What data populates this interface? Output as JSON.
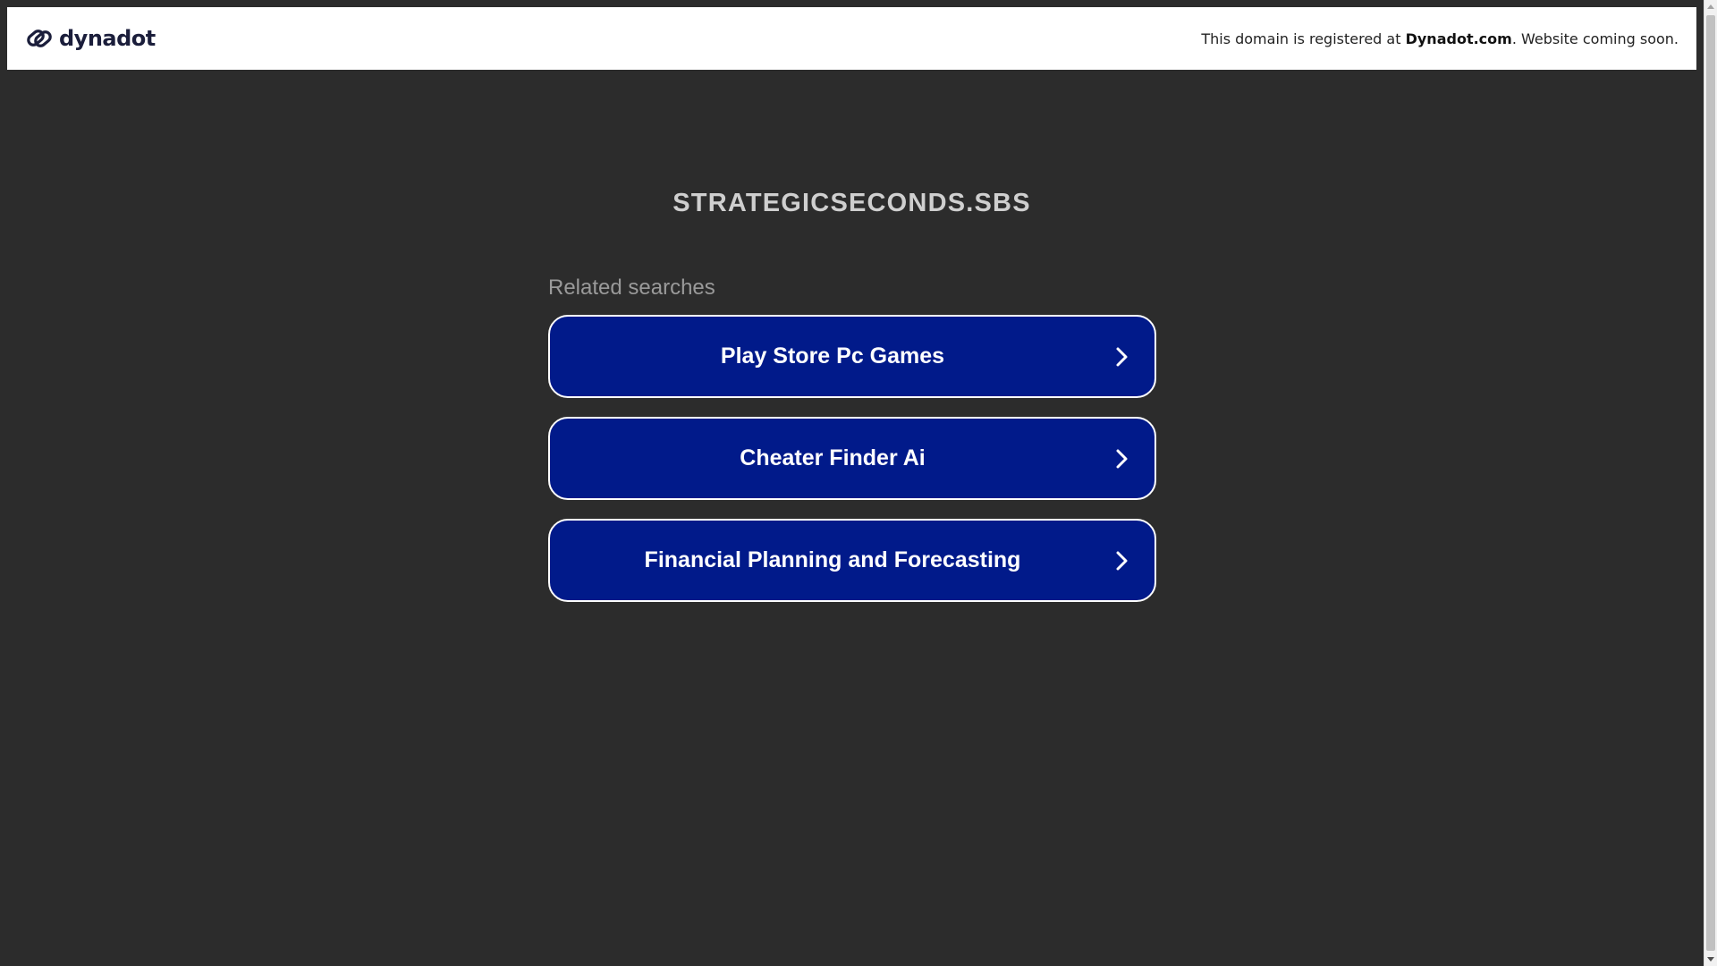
{
  "header": {
    "logo_text": "dynadot",
    "notice_prefix": "This domain is registered at ",
    "notice_brand": "Dynadot.com",
    "notice_suffix": ". Website coming soon."
  },
  "domain": {
    "title": "STRATEGICSECONDS.SBS"
  },
  "related": {
    "heading": "Related searches",
    "items": [
      {
        "label": "Play Store Pc Games"
      },
      {
        "label": "Cheater Finder Ai"
      },
      {
        "label": "Financial Planning and Forecasting"
      }
    ]
  },
  "colors": {
    "background": "#2c2c2c",
    "button": "#011a8a",
    "header": "#ffffff"
  },
  "icons": {
    "logo": "dynadot-link-logo-icon",
    "chevron": "chevron-right-icon"
  }
}
